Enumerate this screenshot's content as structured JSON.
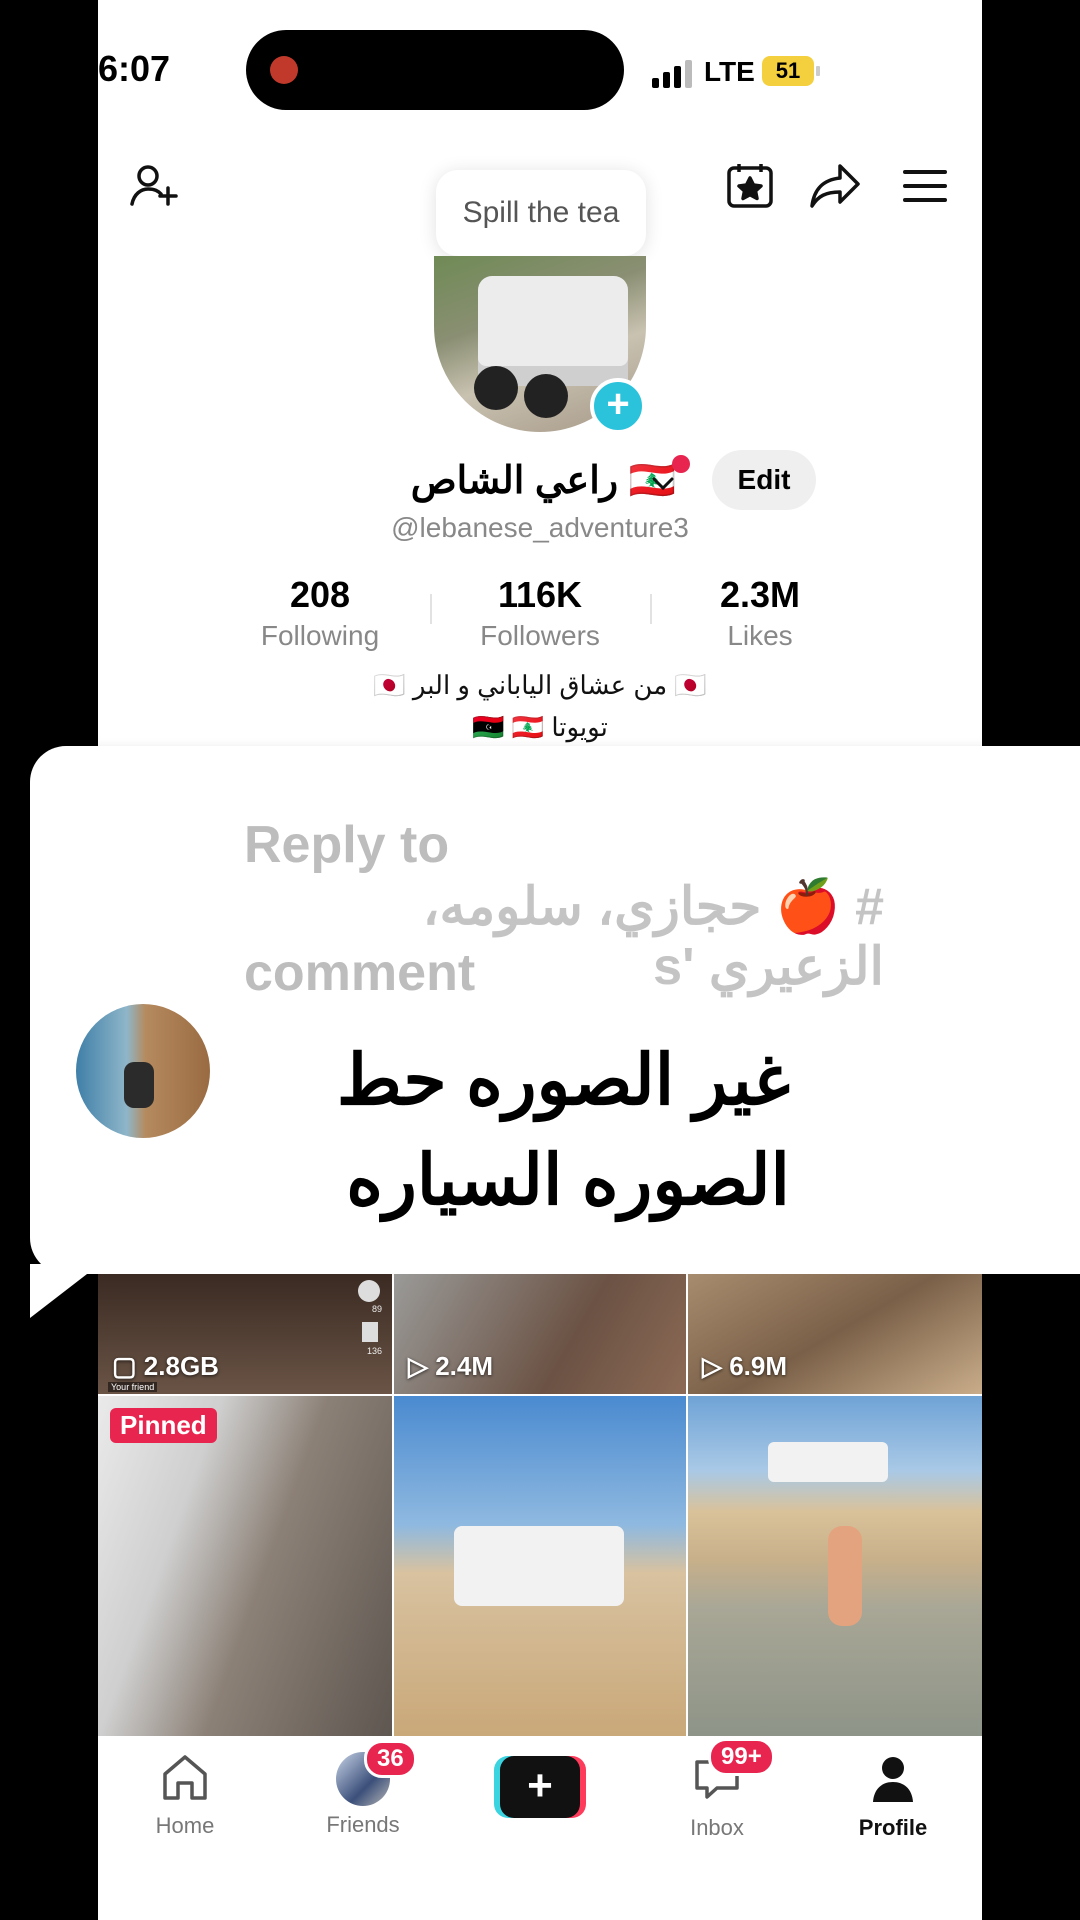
{
  "status_bar": {
    "time": "6:07",
    "network": "LTE",
    "battery": "51"
  },
  "header": {
    "add_friend_icon": "person-add-icon",
    "calendar_icon": "calendar-star-icon",
    "share_icon": "share-icon",
    "menu_icon": "hamburger-menu-icon"
  },
  "tooltip": {
    "text": "Spill the tea"
  },
  "profile": {
    "name": "🇱🇧 راعي الشاص",
    "handle": "@lebanese_adventure3",
    "edit_label": "Edit",
    "stats": [
      {
        "value": "208",
        "label": "Following"
      },
      {
        "value": "116K",
        "label": "Followers"
      },
      {
        "value": "2.3M",
        "label": "Likes"
      }
    ],
    "bio_line1": "🇯🇵 من عشاق الياباني و البر 🇯🇵",
    "bio_line2": "🇱🇾 🇱🇧 تويوتا"
  },
  "reply_overlay": {
    "label_line1": "Reply to",
    "commenter": "# 🍎 حجازي، سلومه، الزعيري 's",
    "label_line3": "comment",
    "comment_text": "غير الصوره حط الصوره السياره"
  },
  "grid": {
    "top_row": [
      {
        "views": "2.8GB",
        "sub": "Your friend",
        "side_counts": [
          "89",
          "136"
        ]
      },
      {
        "views": "2.4M"
      },
      {
        "views": "6.9M"
      }
    ],
    "pinned_label": "Pinned"
  },
  "bottom_nav": {
    "items": [
      {
        "label": "Home"
      },
      {
        "label": "Friends",
        "badge": "36"
      },
      {
        "label": ""
      },
      {
        "label": "Inbox",
        "badge": "99+"
      },
      {
        "label": "Profile"
      }
    ]
  }
}
